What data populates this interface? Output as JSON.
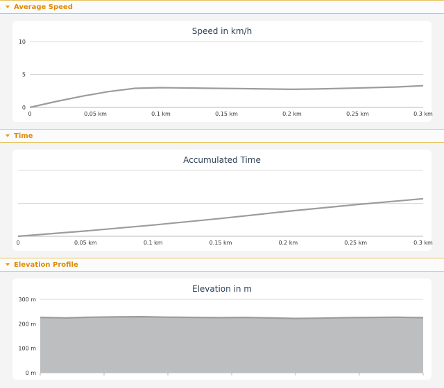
{
  "sections": [
    {
      "title": "Average Speed"
    },
    {
      "title": "Time"
    },
    {
      "title": "Elevation Profile"
    }
  ],
  "colors": {
    "accent": "#e08a00",
    "line": "#9c9c9c",
    "area": "#bdbec0",
    "grid": "#d8d8d8",
    "title": "#2b3e55"
  },
  "chart_data": [
    {
      "type": "line",
      "title": "Speed in km/h",
      "x": [
        0,
        0.02,
        0.04,
        0.06,
        0.08,
        0.1,
        0.12,
        0.14,
        0.16,
        0.18,
        0.2,
        0.22,
        0.24,
        0.26,
        0.28,
        0.3
      ],
      "values": [
        0.0,
        0.9,
        1.7,
        2.4,
        2.9,
        3.0,
        2.95,
        2.9,
        2.85,
        2.8,
        2.75,
        2.8,
        2.9,
        3.0,
        3.1,
        3.3
      ],
      "xticks": [
        "0",
        "0.05 km",
        "0.1 km",
        "0.15 km",
        "0.2 km",
        "0.25 km",
        "0.3 km"
      ],
      "yticks": [
        "0",
        "5",
        "10"
      ],
      "xlim": [
        0,
        0.3
      ],
      "ylim": [
        0,
        10
      ],
      "grid": true
    },
    {
      "type": "line",
      "title": "Accumulated Time",
      "x": [
        0,
        0.05,
        0.1,
        0.15,
        0.2,
        0.25,
        0.3
      ],
      "values": [
        0.0,
        0.08,
        0.17,
        0.27,
        0.38,
        0.48,
        0.57
      ],
      "xticks": [
        "0",
        "0.05 km",
        "0.1 km",
        "0.15 km",
        "0.2 km",
        "0.25 km",
        "0.3 km"
      ],
      "yticks": [],
      "xlim": [
        0,
        0.3
      ],
      "ylim": [
        0,
        1
      ],
      "grid": true
    },
    {
      "type": "area",
      "title": "Elevation in m",
      "x": [
        0,
        0.02,
        0.04,
        0.06,
        0.08,
        0.1,
        0.12,
        0.14,
        0.16,
        0.18,
        0.2,
        0.22,
        0.24,
        0.26,
        0.28,
        0.3
      ],
      "values": [
        226,
        224,
        227,
        228,
        229,
        227,
        226,
        225,
        226,
        224,
        222,
        223,
        225,
        226,
        227,
        225
      ],
      "yticks": [
        "0 m",
        "100 m",
        "200 m",
        "300 m"
      ],
      "xlim": [
        0,
        0.3
      ],
      "ylim": [
        0,
        300
      ],
      "grid": true
    }
  ]
}
